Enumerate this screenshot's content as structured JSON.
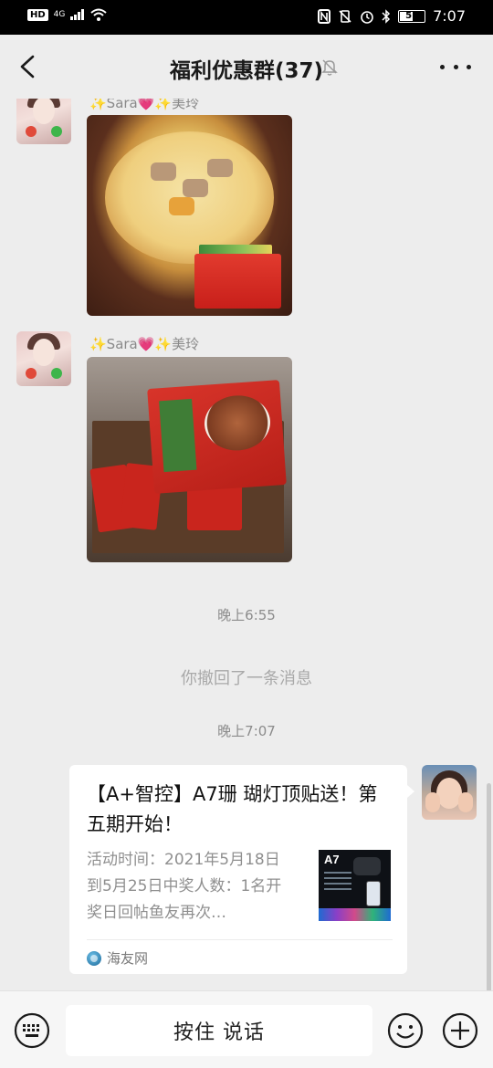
{
  "status_bar": {
    "left": "HD",
    "network": "4G",
    "battery": "51",
    "time": "7:07"
  },
  "header": {
    "title": "福利优惠群(37)"
  },
  "messages": [
    {
      "sender": "✨Sara💗✨美玲",
      "type": "image"
    },
    {
      "sender": "✨Sara💗✨美玲",
      "type": "image"
    }
  ],
  "time_labels": [
    "晚上6:55",
    "晚上7:07"
  ],
  "system_message": "你撤回了一条消息",
  "link_card": {
    "title": "【A+智控】A7珊 瑚灯顶贴送！第五期开始！",
    "description": "活动时间：2021年5月18日到5月25日中奖人数：1名开奖日回帖鱼友再次…",
    "thumb_label": "A7",
    "source": "海友网"
  },
  "input_bar": {
    "hold_to_talk": "按住 说话"
  },
  "icons": [
    "back-icon",
    "mute-icon",
    "more-icon",
    "keyboard-icon",
    "emoji-icon",
    "plus-icon"
  ],
  "colors": {
    "background": "#ededed",
    "status_bar": "#000000",
    "card": "#ffffff",
    "muted_text": "#8c8c8c"
  }
}
